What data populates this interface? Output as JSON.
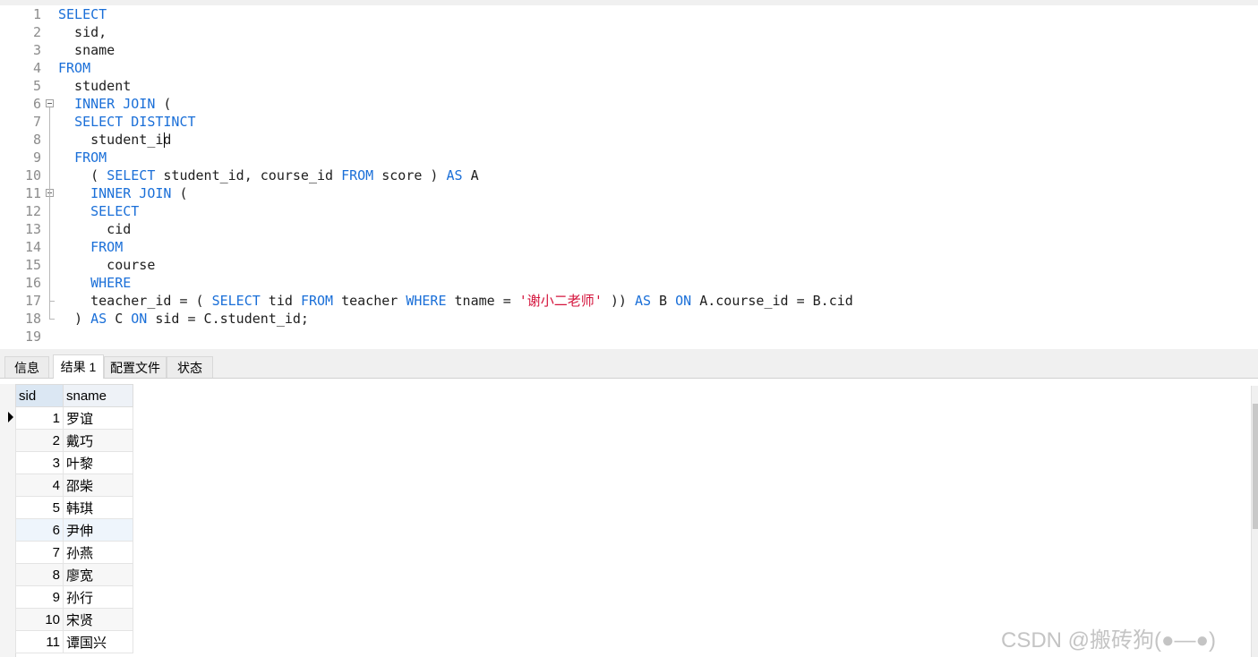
{
  "editor": {
    "lines": [
      {
        "num": "1",
        "tokens": [
          {
            "t": "SELECT",
            "k": "kw"
          }
        ]
      },
      {
        "num": "2",
        "tokens": [
          {
            "t": "  sid,",
            "k": ""
          }
        ]
      },
      {
        "num": "3",
        "tokens": [
          {
            "t": "  sname",
            "k": ""
          }
        ]
      },
      {
        "num": "4",
        "tokens": [
          {
            "t": "FROM",
            "k": "kw"
          }
        ]
      },
      {
        "num": "5",
        "tokens": [
          {
            "t": "  student",
            "k": ""
          }
        ]
      },
      {
        "num": "6",
        "tokens": [
          {
            "t": "  ",
            "k": ""
          },
          {
            "t": "INNER JOIN",
            "k": "kw"
          },
          {
            "t": " (",
            "k": ""
          }
        ]
      },
      {
        "num": "7",
        "tokens": [
          {
            "t": "  ",
            "k": ""
          },
          {
            "t": "SELECT DISTINCT",
            "k": "kw"
          }
        ]
      },
      {
        "num": "8",
        "tokens": [
          {
            "t": "    student_id",
            "k": ""
          }
        ]
      },
      {
        "num": "9",
        "tokens": [
          {
            "t": "  ",
            "k": ""
          },
          {
            "t": "FROM",
            "k": "kw"
          }
        ]
      },
      {
        "num": "10",
        "tokens": [
          {
            "t": "    ( ",
            "k": ""
          },
          {
            "t": "SELECT",
            "k": "kw"
          },
          {
            "t": " student_id, course_id ",
            "k": ""
          },
          {
            "t": "FROM",
            "k": "kw"
          },
          {
            "t": " score ) ",
            "k": ""
          },
          {
            "t": "AS",
            "k": "kw"
          },
          {
            "t": " A",
            "k": ""
          }
        ]
      },
      {
        "num": "11",
        "tokens": [
          {
            "t": "    ",
            "k": ""
          },
          {
            "t": "INNER JOIN",
            "k": "kw"
          },
          {
            "t": " (",
            "k": ""
          }
        ]
      },
      {
        "num": "12",
        "tokens": [
          {
            "t": "    ",
            "k": ""
          },
          {
            "t": "SELECT",
            "k": "kw"
          }
        ]
      },
      {
        "num": "13",
        "tokens": [
          {
            "t": "      cid",
            "k": ""
          }
        ]
      },
      {
        "num": "14",
        "tokens": [
          {
            "t": "    ",
            "k": ""
          },
          {
            "t": "FROM",
            "k": "kw"
          }
        ]
      },
      {
        "num": "15",
        "tokens": [
          {
            "t": "      course",
            "k": ""
          }
        ]
      },
      {
        "num": "16",
        "tokens": [
          {
            "t": "    ",
            "k": ""
          },
          {
            "t": "WHERE",
            "k": "kw"
          }
        ]
      },
      {
        "num": "17",
        "tokens": [
          {
            "t": "    teacher_id = ( ",
            "k": ""
          },
          {
            "t": "SELECT",
            "k": "kw"
          },
          {
            "t": " tid ",
            "k": ""
          },
          {
            "t": "FROM",
            "k": "kw"
          },
          {
            "t": " teacher ",
            "k": ""
          },
          {
            "t": "WHERE",
            "k": "kw"
          },
          {
            "t": " tname = ",
            "k": ""
          },
          {
            "t": "'谢小二老师'",
            "k": "str"
          },
          {
            "t": " )) ",
            "k": ""
          },
          {
            "t": "AS",
            "k": "kw"
          },
          {
            "t": " B ",
            "k": ""
          },
          {
            "t": "ON",
            "k": "kw"
          },
          {
            "t": " A.course_id = B.cid",
            "k": ""
          }
        ]
      },
      {
        "num": "18",
        "tokens": [
          {
            "t": "  ) ",
            "k": ""
          },
          {
            "t": "AS",
            "k": "kw"
          },
          {
            "t": " C ",
            "k": ""
          },
          {
            "t": "ON",
            "k": "kw"
          },
          {
            "t": " sid = C.student_id;",
            "k": ""
          }
        ]
      },
      {
        "num": "19",
        "tokens": []
      }
    ]
  },
  "tabs": [
    {
      "label": "信息",
      "active": false
    },
    {
      "label": "结果 1",
      "active": true
    },
    {
      "label": "配置文件",
      "active": false
    },
    {
      "label": "状态",
      "active": false
    }
  ],
  "results": {
    "columns": [
      "sid",
      "sname"
    ],
    "rows": [
      [
        "1",
        "罗谊"
      ],
      [
        "2",
        "戴巧"
      ],
      [
        "3",
        "叶黎"
      ],
      [
        "4",
        "邵柴"
      ],
      [
        "5",
        "韩琪"
      ],
      [
        "6",
        "尹伸"
      ],
      [
        "7",
        "孙燕"
      ],
      [
        "8",
        "廖宽"
      ],
      [
        "9",
        "孙行"
      ],
      [
        "10",
        "宋贤"
      ],
      [
        "11",
        "谭国兴"
      ]
    ]
  },
  "watermark": "CSDN @搬砖狗(●—●)",
  "colors": {
    "keyword": "#1a6fd8",
    "string": "#d4143c"
  }
}
